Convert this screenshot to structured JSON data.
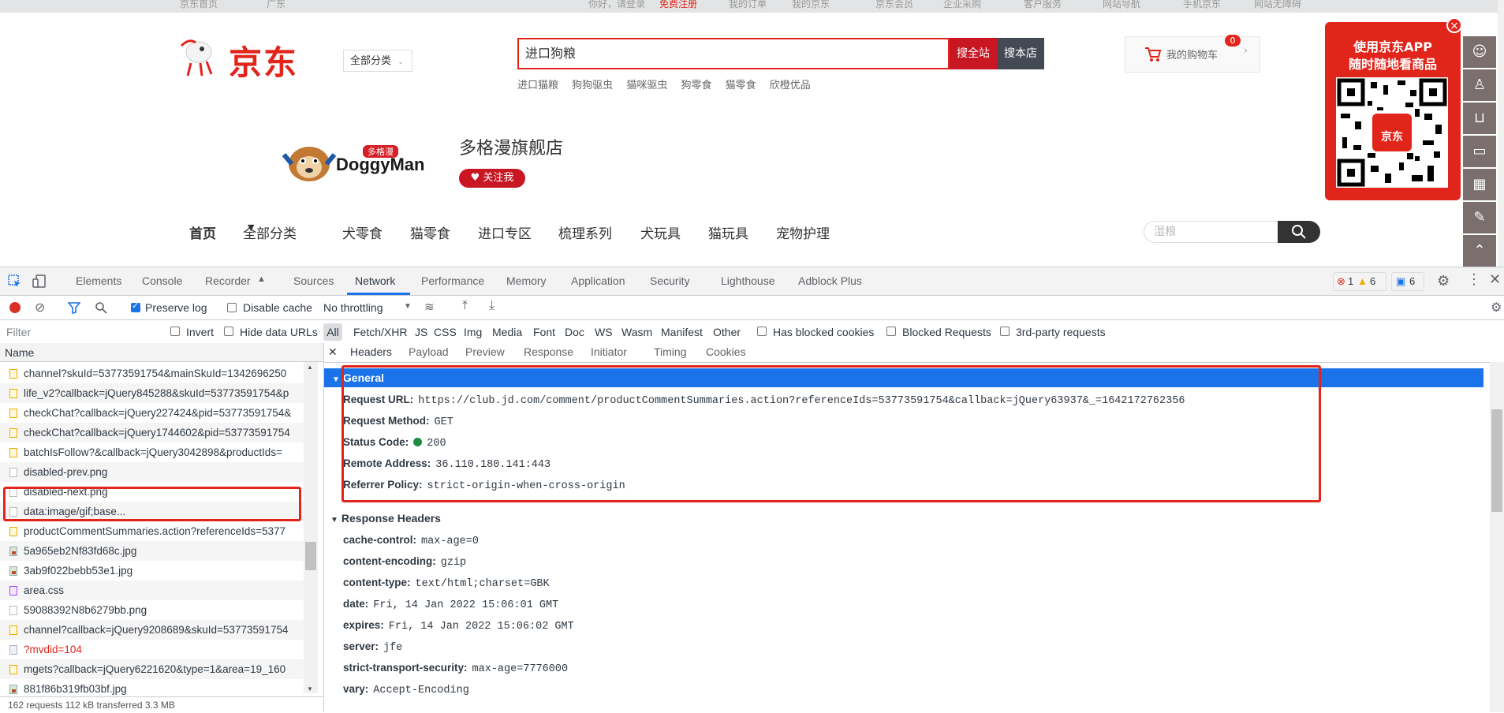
{
  "jd": {
    "topbar": [
      "京东首页",
      "广东",
      "你好，请登录",
      "免费注册",
      "我的订单",
      "我的京东",
      "京东会员",
      "企业采购",
      "客户服务",
      "网站导航",
      "手机京东",
      "网站无障碍"
    ],
    "logo_text": "京东",
    "category_select": "全部分类",
    "search_value": "进口狗粮",
    "search_all_label": "搜全站",
    "search_shop_label": "搜本店",
    "hot_words": [
      "进口猫粮",
      "狗狗驱虫",
      "猫咪驱虫",
      "狗零食",
      "猫零食",
      "欣橙优品"
    ],
    "cart_label": "我的购物车",
    "cart_count": "0",
    "app_promo_line1": "使用京东APP",
    "app_promo_line2": "随时随地看商品",
    "store_logo_text": "DoggyMan",
    "store_logo_cn": "多格漫",
    "store_name": "多格漫旗舰店",
    "follow_label": "关注我",
    "store_nav": [
      "首页",
      "全部分类",
      "犬零食",
      "猫零食",
      "进口专区",
      "梳理系列",
      "犬玩具",
      "猫玩具",
      "宠物护理"
    ],
    "store_search_placeholder": "湿粮"
  },
  "devtools": {
    "tabs": [
      "Elements",
      "Console",
      "Recorder",
      "Sources",
      "Network",
      "Performance",
      "Memory",
      "Application",
      "Security",
      "Lighthouse",
      "Adblock Plus"
    ],
    "active_tab": "Network",
    "errors": "1",
    "warnings": "6",
    "messages": "6",
    "toolbar": {
      "preserve_log": "Preserve log",
      "disable_cache": "Disable cache",
      "throttling": "No throttling"
    },
    "filter": {
      "placeholder": "Filter",
      "invert": "Invert",
      "hide_data_urls": "Hide data URLs",
      "types": [
        "All",
        "Fetch/XHR",
        "JS",
        "CSS",
        "Img",
        "Media",
        "Font",
        "Doc",
        "WS",
        "Wasm",
        "Manifest",
        "Other"
      ],
      "has_blocked_cookies": "Has blocked cookies",
      "blocked_requests": "Blocked Requests",
      "third_party": "3rd-party requests"
    },
    "name_header": "Name",
    "requests": [
      {
        "name": "channel?skuId=53773591754&mainSkuId=1342696250",
        "type": "js"
      },
      {
        "name": "life_v2?callback=jQuery845288&skuId=53773591754&p",
        "type": "js"
      },
      {
        "name": "checkChat?callback=jQuery227424&pid=53773591754&",
        "type": "js"
      },
      {
        "name": "checkChat?callback=jQuery1744602&pid=53773591754",
        "type": "js"
      },
      {
        "name": "batchIsFollow?&callback=jQuery3042898&productIds=",
        "type": "js"
      },
      {
        "name": "disabled-prev.png",
        "type": "blank"
      },
      {
        "name": "disabled-next.png",
        "type": "blank"
      },
      {
        "name": "data:image/gif;base...",
        "type": "blank"
      },
      {
        "name": "productCommentSummaries.action?referenceIds=5377",
        "type": "js"
      },
      {
        "name": "5a965eb2Nf83fd68c.jpg",
        "type": "img"
      },
      {
        "name": "3ab9f022bebb53e1.jpg",
        "type": "img"
      },
      {
        "name": "area.css",
        "type": "css"
      },
      {
        "name": "59088392N8b6279bb.png",
        "type": "blank"
      },
      {
        "name": "channel?callback=jQuery9208689&skuId=53773591754",
        "type": "js"
      },
      {
        "name": "?mvdid=104",
        "type": "doc"
      },
      {
        "name": "mgets?callback=jQuery6221620&type=1&area=19_160",
        "type": "js"
      },
      {
        "name": "881f86b319fb03bf.jpg",
        "type": "img"
      }
    ],
    "status_bar": "162 requests   112 kB transferred   3.3 MB",
    "detail_tabs": [
      "Headers",
      "Payload",
      "Preview",
      "Response",
      "Initiator",
      "Timing",
      "Cookies"
    ],
    "general_title": "General",
    "general": [
      {
        "key": "Request URL:",
        "value": "https://club.jd.com/comment/productCommentSummaries.action?referenceIds=53773591754&callback=jQuery63937&_=1642172762356"
      },
      {
        "key": "Request Method:",
        "value": "GET"
      },
      {
        "key": "Status Code:",
        "value": "200"
      },
      {
        "key": "Remote Address:",
        "value": "36.110.180.141:443"
      },
      {
        "key": "Referrer Policy:",
        "value": "strict-origin-when-cross-origin"
      }
    ],
    "response_headers_title": "Response Headers",
    "response_headers": [
      {
        "key": "cache-control:",
        "value": "max-age=0"
      },
      {
        "key": "content-encoding:",
        "value": "gzip"
      },
      {
        "key": "content-type:",
        "value": "text/html;charset=GBK"
      },
      {
        "key": "date:",
        "value": "Fri, 14 Jan 2022 15:06:01 GMT"
      },
      {
        "key": "expires:",
        "value": "Fri, 14 Jan 2022 15:06:02 GMT"
      },
      {
        "key": "server:",
        "value": "jfe"
      },
      {
        "key": "strict-transport-security:",
        "value": "max-age=7776000"
      },
      {
        "key": "vary:",
        "value": "Accept-Encoding"
      }
    ],
    "colors": {
      "accent": "#1a73e8",
      "jd_red": "#e1251b",
      "status_ok": "#1e8e3e"
    }
  }
}
